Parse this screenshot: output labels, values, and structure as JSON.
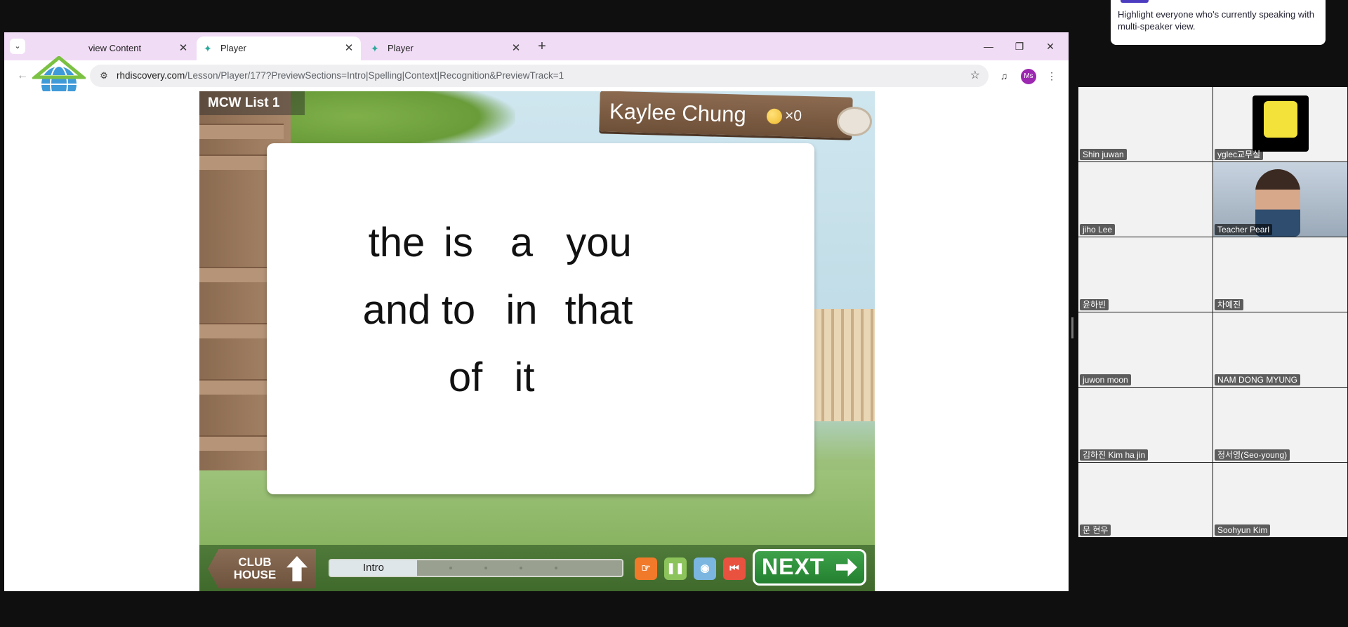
{
  "browser": {
    "tabs": [
      {
        "title": "view Content",
        "active": false
      },
      {
        "title": "Player",
        "active": true
      },
      {
        "title": "Player",
        "active": false
      }
    ],
    "url_host": "rhdiscovery.com",
    "url_path": "/Lesson/Player/177?PreviewSections=Intro|Spelling|Context|Recognition&PreviewTrack=1",
    "profile_initials": "Ms"
  },
  "game": {
    "lesson_title": "MCW List 1",
    "student_name": "Kaylee Chung",
    "coin_count": "×0",
    "words": [
      "the",
      "is",
      "a",
      "you",
      "and",
      "to",
      "in",
      "that",
      "of",
      "it"
    ],
    "clubhouse_line1": "CLUB",
    "clubhouse_line2": "HOUSE",
    "progress_section": "Intro",
    "next_label": "NEXT"
  },
  "meeting": {
    "notice": "Highlight everyone who's currently speaking with multi-speaker view.",
    "participants": [
      "Shin juwan",
      "yglec교무실",
      "jiho Lee",
      "Teacher Pearl",
      "윤하빈",
      "차예진",
      "juwon moon",
      "NAM DONG MYUNG",
      "김하진 Kim ha jin",
      "정서영(Seo-young)",
      "문 현우",
      "Soohyun Kim"
    ]
  },
  "colors": {
    "tabbar": "#f1dcf6",
    "speaking_outline": "#23d959",
    "next_button": "#2e9a3d"
  }
}
